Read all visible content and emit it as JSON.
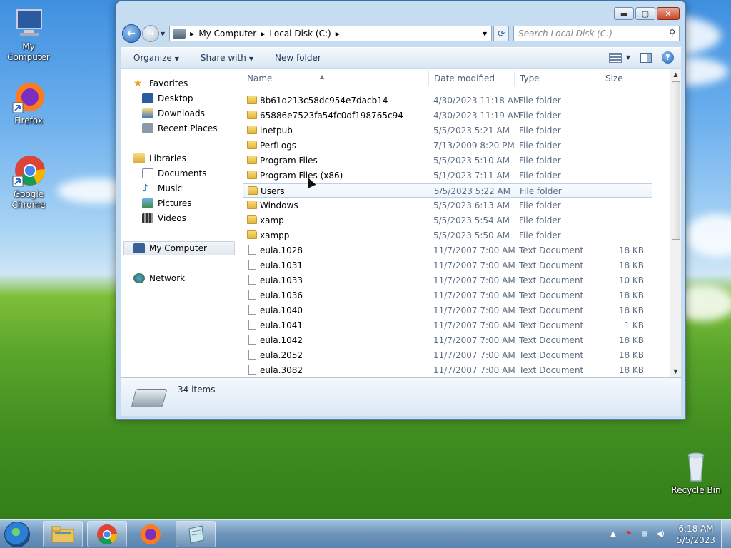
{
  "desktop": {
    "icons": [
      {
        "label": "My Computer"
      },
      {
        "label": "Firefox"
      },
      {
        "label": "Google Chrome"
      },
      {
        "label": "Recycle Bin"
      }
    ]
  },
  "window": {
    "address": {
      "segment1": "My Computer",
      "segment2": "Local Disk (C:)"
    },
    "search_placeholder": "Search Local Disk (C:)",
    "toolbar": {
      "organize": "Organize",
      "share_with": "Share with",
      "new_folder": "New folder"
    },
    "nav": {
      "favorites": "Favorites",
      "desktop": "Desktop",
      "downloads": "Downloads",
      "recent_places": "Recent Places",
      "libraries": "Libraries",
      "documents": "Documents",
      "music": "Music",
      "pictures": "Pictures",
      "videos": "Videos",
      "my_computer": "My Computer",
      "network": "Network"
    },
    "columns": {
      "name": "Name",
      "date_modified": "Date modified",
      "type": "Type",
      "size": "Size"
    },
    "files": [
      {
        "name": "8b61d213c58dc954e7dacb14",
        "date": "4/30/2023 11:18 AM",
        "type": "File folder",
        "size": "",
        "kind": "folder"
      },
      {
        "name": "65886e7523fa54fc0df198765c94",
        "date": "4/30/2023 11:19 AM",
        "type": "File folder",
        "size": "",
        "kind": "folder"
      },
      {
        "name": "inetpub",
        "date": "5/5/2023 5:21 AM",
        "type": "File folder",
        "size": "",
        "kind": "folder"
      },
      {
        "name": "PerfLogs",
        "date": "7/13/2009 8:20 PM",
        "type": "File folder",
        "size": "",
        "kind": "folder"
      },
      {
        "name": "Program Files",
        "date": "5/5/2023 5:10 AM",
        "type": "File folder",
        "size": "",
        "kind": "folder"
      },
      {
        "name": "Program Files (x86)",
        "date": "5/1/2023 7:11 AM",
        "type": "File folder",
        "size": "",
        "kind": "folder"
      },
      {
        "name": "Users",
        "date": "5/5/2023 5:22 AM",
        "type": "File folder",
        "size": "",
        "kind": "folder"
      },
      {
        "name": "Windows",
        "date": "5/5/2023 6:13 AM",
        "type": "File folder",
        "size": "",
        "kind": "folder"
      },
      {
        "name": "xamp",
        "date": "5/5/2023 5:54 AM",
        "type": "File folder",
        "size": "",
        "kind": "folder"
      },
      {
        "name": "xampp",
        "date": "5/5/2023 5:50 AM",
        "type": "File folder",
        "size": "",
        "kind": "folder"
      },
      {
        "name": "eula.1028",
        "date": "11/7/2007 7:00 AM",
        "type": "Text Document",
        "size": "18 KB",
        "kind": "doc"
      },
      {
        "name": "eula.1031",
        "date": "11/7/2007 7:00 AM",
        "type": "Text Document",
        "size": "18 KB",
        "kind": "doc"
      },
      {
        "name": "eula.1033",
        "date": "11/7/2007 7:00 AM",
        "type": "Text Document",
        "size": "10 KB",
        "kind": "doc"
      },
      {
        "name": "eula.1036",
        "date": "11/7/2007 7:00 AM",
        "type": "Text Document",
        "size": "18 KB",
        "kind": "doc"
      },
      {
        "name": "eula.1040",
        "date": "11/7/2007 7:00 AM",
        "type": "Text Document",
        "size": "18 KB",
        "kind": "doc"
      },
      {
        "name": "eula.1041",
        "date": "11/7/2007 7:00 AM",
        "type": "Text Document",
        "size": "1 KB",
        "kind": "doc"
      },
      {
        "name": "eula.1042",
        "date": "11/7/2007 7:00 AM",
        "type": "Text Document",
        "size": "18 KB",
        "kind": "doc"
      },
      {
        "name": "eula.2052",
        "date": "11/7/2007 7:00 AM",
        "type": "Text Document",
        "size": "18 KB",
        "kind": "doc"
      },
      {
        "name": "eula.3082",
        "date": "11/7/2007 7:00 AM",
        "type": "Text Document",
        "size": "18 KB",
        "kind": "doc"
      }
    ],
    "hovered_file": "Users",
    "status": {
      "items_count": "34 items"
    }
  },
  "taskbar": {
    "clock_time": "6:18 AM",
    "clock_date": "5/5/2023"
  },
  "colors": {
    "accent": "#2a6cc0",
    "folder": "#e2b53c"
  }
}
